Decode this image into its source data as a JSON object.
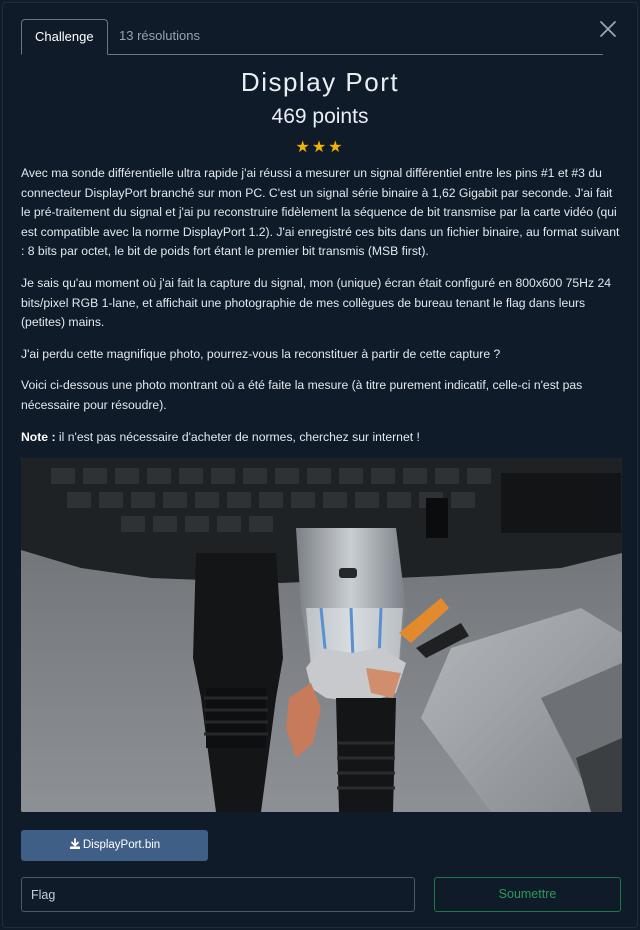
{
  "tabs": [
    {
      "label": "Challenge",
      "active": true
    },
    {
      "label": "13 résolutions",
      "active": false
    }
  ],
  "challenge": {
    "title": "Display Port",
    "points": "469 points",
    "stars": "★★★",
    "difficulty_stars": 3
  },
  "description": {
    "p1": "Avec ma sonde différentielle ultra rapide j'ai réussi a mesurer un signal différentiel entre les pins #1 et #3 du connecteur DisplayPort branché sur mon PC. C'est un signal série binaire à 1,62 Gigabit par seconde. J'ai fait le pré-traitement du signal et j'ai pu reconstruire fidèlement la séquence de bit transmise par la carte vidéo (qui est compatible avec la norme DisplayPort 1.2). J'ai enregistré ces bits dans un fichier binaire, au format suivant : 8 bits par octet, le bit de poids fort étant le premier bit transmis (MSB first).",
    "p2": "Je sais qu'au moment où j'ai fait la capture du signal, mon (unique) écran était configuré en 800x600 75Hz 24 bits/pixel RGB 1-lane, et affichait une photographie de mes collègues de bureau tenant le flag dans leurs (petites) mains.",
    "p3": "J'ai perdu cette magnifique photo, pourrez-vous la reconstituer à partir de cette capture ?",
    "p4": "Voici ci-dessous une photo montrant où a été faite la mesure (à titre purement indicatif, celle-ci n'est pas nécessaire pour résoudre).",
    "note_label": "Note :",
    "note_text": " il n'est pas nécessaire d'acheter de normes, cherchez sur internet !"
  },
  "download": {
    "label": "DisplayPort.bin",
    "icon": "download-icon"
  },
  "flag": {
    "placeholder": "Flag",
    "value": ""
  },
  "submit": {
    "label": "Soumettre"
  },
  "colors": {
    "background": "#0f1b29",
    "star": "#f2b203",
    "download_button": "#3f5f86",
    "submit_border": "#1c7a45",
    "submit_text": "#2d9a58"
  }
}
